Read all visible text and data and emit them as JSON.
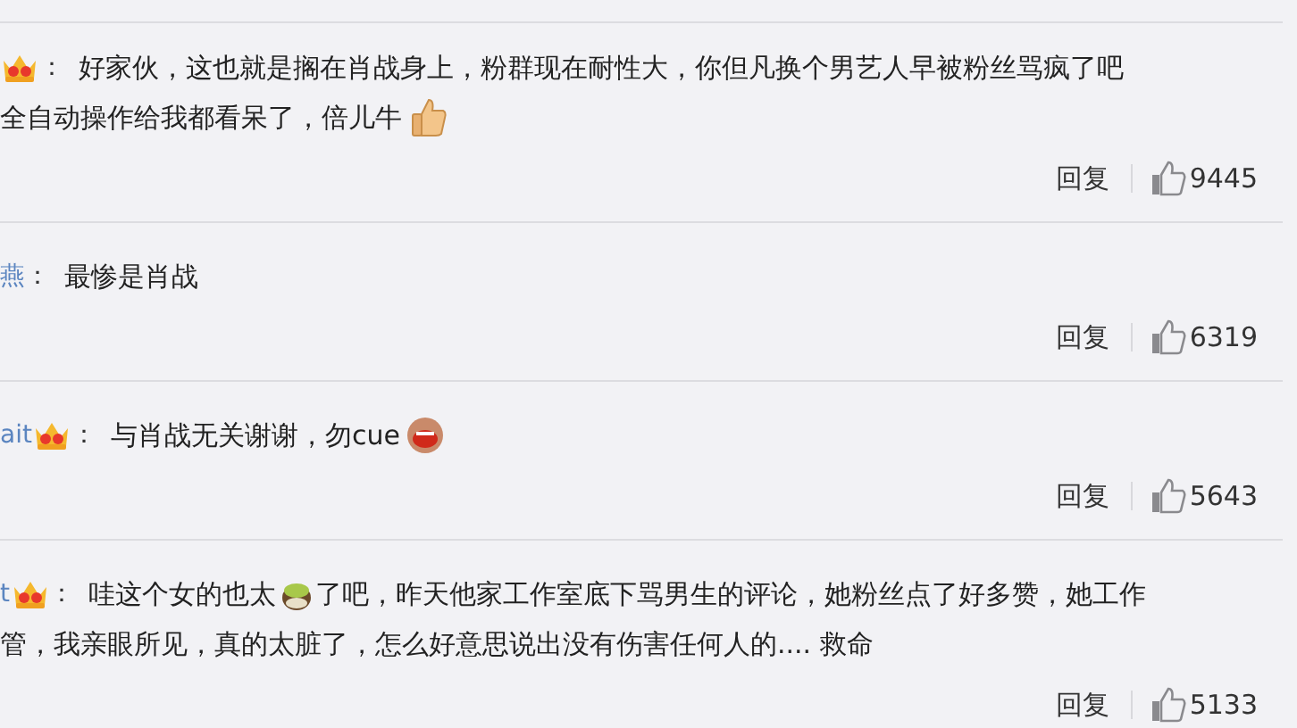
{
  "comments": [
    {
      "crown": true,
      "colon": "：",
      "lines": [
        [
          {
            "kind": "text",
            "text": "好家伙，这也就是搁在肖战身上，粉群现在耐性大，你但凡换个男艺人早被粉丝骂疯了吧"
          }
        ],
        [
          {
            "kind": "text",
            "text": "全自动操作给我都看呆了，倍儿牛"
          },
          {
            "kind": "thumbs-up"
          }
        ]
      ],
      "reply": "回复",
      "likes": "9445"
    },
    {
      "user": "燕",
      "crown": false,
      "colon": "：",
      "lines": [
        [
          {
            "kind": "text",
            "text": "最惨是肖战"
          }
        ]
      ],
      "reply": "回复",
      "likes": "6319"
    },
    {
      "user": "ait",
      "crown": true,
      "colon": "：",
      "lines": [
        [
          {
            "kind": "text",
            "text": "与肖战无关谢谢，勿cue"
          },
          {
            "kind": "laughing"
          }
        ]
      ],
      "reply": "回复",
      "likes": "5643"
    },
    {
      "user": "t",
      "crown": true,
      "colon": "：",
      "lines": [
        [
          {
            "kind": "text",
            "text": "哇这个女的也太"
          },
          {
            "kind": "tea-cup"
          },
          {
            "kind": "text",
            "text": "了吧，昨天他家工作室底下骂男生的评论，她粉丝点了好多赞，她工作"
          }
        ],
        [
          {
            "kind": "text",
            "text": "管，我亲眼所见，真的太脏了，怎么好意思说出没有伤害任何人的.... 救命"
          }
        ]
      ],
      "reply": "回复",
      "likes": "5133"
    }
  ]
}
